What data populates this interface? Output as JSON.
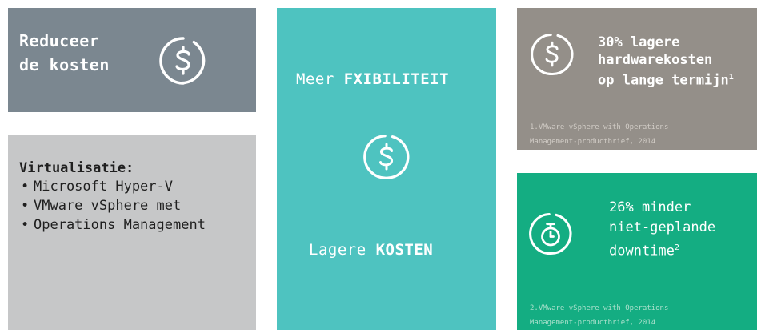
{
  "reduce_panel": {
    "title_line1": "Reduceer",
    "title_line2": "de kosten",
    "icon": "dollar-circle-icon"
  },
  "virtualization_panel": {
    "heading": "Virtualisatie:",
    "items": [
      "Microsoft Hyper-V",
      "VMware vSphere met",
      "Operations Management"
    ]
  },
  "middle_panel": {
    "top_prefix": "Meer",
    "top_bold": "FXIBILITEIT",
    "icon": "dollar-circle-icon",
    "bottom_prefix": "Lagere",
    "bottom_bold": "KOSTEN"
  },
  "hardware_panel": {
    "icon": "dollar-circle-icon",
    "line1": "30% lagere",
    "line2": "hardwarekosten",
    "line3": "op lange termijn",
    "footnote_mark": "1",
    "footnote_line1": "1.VMware vSphere with Operations",
    "footnote_line2": "Management-productbrief, 2014"
  },
  "downtime_panel": {
    "icon": "stopwatch-icon",
    "line1": "26% minder",
    "line2": "niet-geplande",
    "line3": "downtime",
    "footnote_mark": "2",
    "footnote_line1": "2.VMware vSphere with Operations",
    "footnote_line2": "Management-productbrief, 2014"
  },
  "colors": {
    "slate": "#7b8790",
    "light_gray": "#c6c7c8",
    "teal": "#4ec3c0",
    "warm_gray": "#948f89",
    "green": "#14ad82"
  }
}
